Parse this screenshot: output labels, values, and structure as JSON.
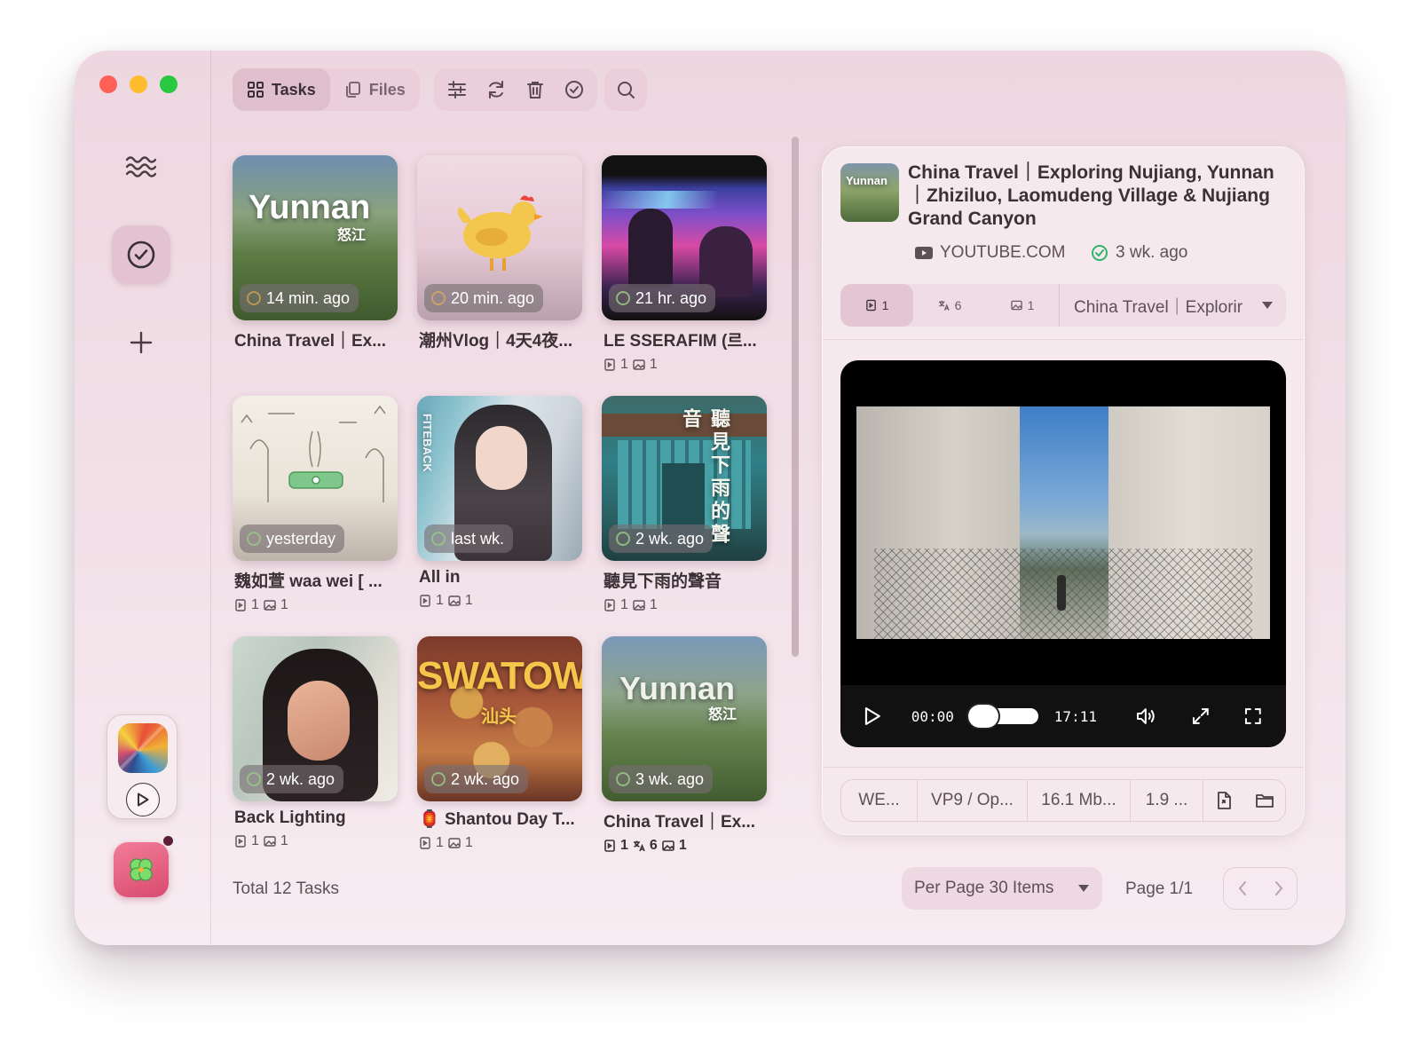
{
  "toolbar": {
    "tasks_label": "Tasks",
    "files_label": "Files"
  },
  "tasks": [
    {
      "title": "China Travel｜Ex...",
      "time": "14 min. ago"
    },
    {
      "title": "潮州Vlog｜4天4夜...",
      "time": "20 min. ago"
    },
    {
      "title": "LE SSERAFIM (르...",
      "time": "21 hr. ago",
      "meta": [
        "1",
        "1"
      ]
    },
    {
      "title": "魏如萱 waa wei [ ...",
      "time": "yesterday",
      "meta": [
        "1",
        "1"
      ]
    },
    {
      "title": "All in",
      "time": "last wk.",
      "meta": [
        "1",
        "1"
      ]
    },
    {
      "title": "聽見下雨的聲音",
      "time": "2 wk. ago",
      "meta": [
        "1",
        "1"
      ]
    },
    {
      "title": "Back Lighting",
      "time": "2 wk. ago",
      "meta": [
        "1",
        "1"
      ]
    },
    {
      "title": "Shantou Day T...",
      "time": "2 wk. ago",
      "emoji": "🏮",
      "meta": [
        "1",
        "1"
      ]
    },
    {
      "title": "China Travel｜Ex...",
      "time": "3 wk. ago",
      "meta": [
        "1",
        "6",
        "1"
      ]
    }
  ],
  "thumb_text": {
    "yunnan": "Yunnan",
    "nujiang": "怒江",
    "swatow": "SWATOW",
    "shantou": "汕头",
    "tingjian": "聽見下雨的聲音",
    "fitback": "FITEBACK"
  },
  "footer": {
    "total": "Total 12 Tasks",
    "per_page": "Per Page 30 Items",
    "page": "Page 1/1"
  },
  "detail": {
    "title": "China Travel｜Exploring Nujiang, Yunnan｜Zhiziluo, Laomudeng Village & Nujiang Grand Canyon",
    "source": "YOUTUBE.COM",
    "time": "3 wk. ago",
    "tab_video_count": "1",
    "tab_subtitle_count": "6",
    "tab_image_count": "1",
    "selected_title": "China Travel｜Explorir",
    "video": {
      "current": "00:00",
      "duration": "17:11"
    },
    "info": {
      "format": "WE...",
      "codec": "VP9 / Op...",
      "size": "16.1 Mb...",
      "extra": "1.9 ..."
    }
  },
  "colors": {
    "accent": "#e0bfcc",
    "success": "#2fb56a"
  }
}
